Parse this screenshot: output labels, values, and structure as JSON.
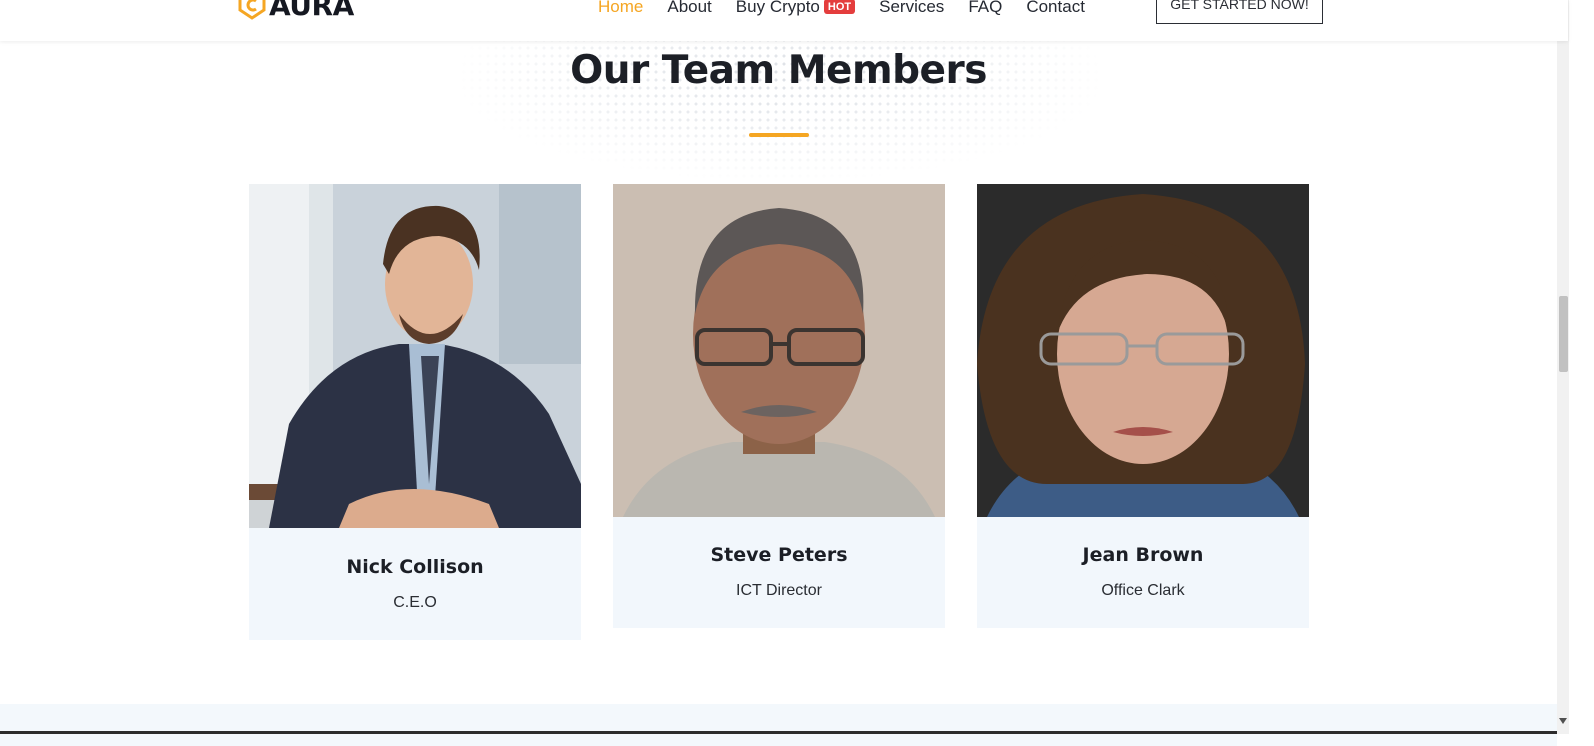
{
  "header": {
    "logo_text": "AURA",
    "nav": {
      "home": "Home",
      "about": "About",
      "buy_crypto": "Buy Crypto",
      "hot_badge": "HOT",
      "services": "Services",
      "faq": "FAQ",
      "contact": "Contact"
    },
    "cta_label": "GET STARTED NOW!"
  },
  "section": {
    "title": "Our Team Members"
  },
  "team": [
    {
      "name": "Nick Collison",
      "role": "C.E.O"
    },
    {
      "name": "Steve Peters",
      "role": "ICT Director"
    },
    {
      "name": "Jean Brown",
      "role": "Office Clark"
    }
  ],
  "colors": {
    "accent": "#f5a623",
    "hot_badge": "#e43d3d",
    "card_bg": "#f2f7fc",
    "heading": "#1c1f26"
  }
}
